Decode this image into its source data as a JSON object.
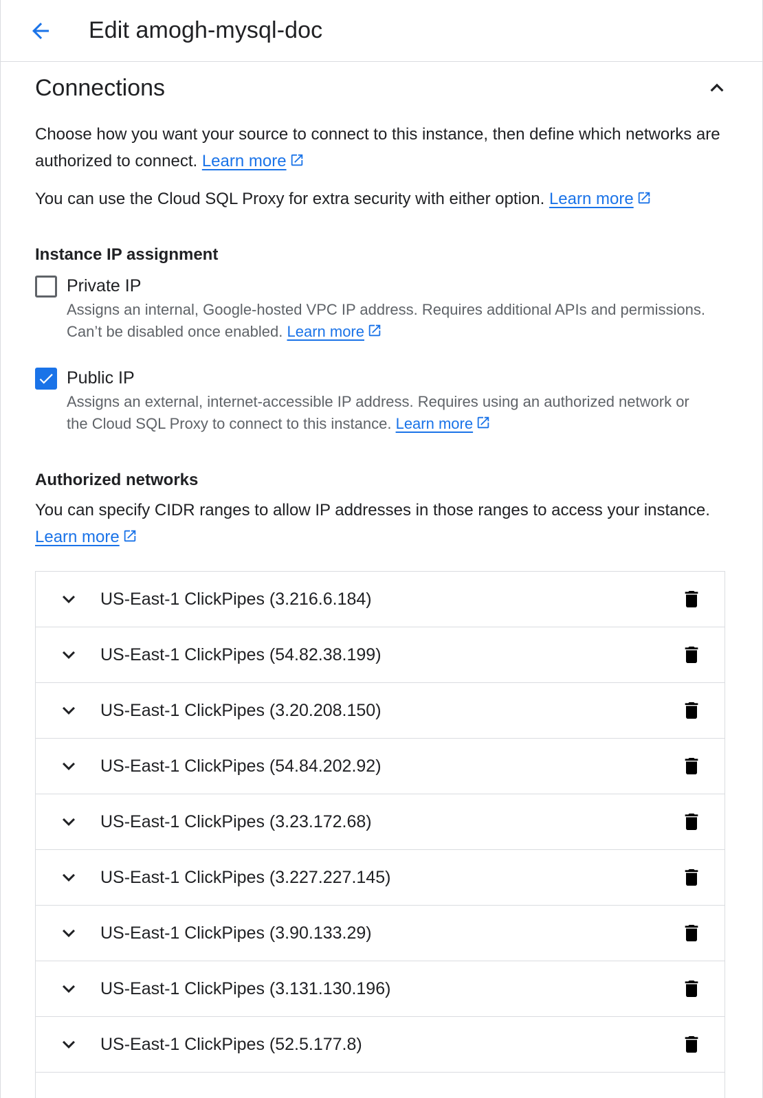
{
  "header": {
    "title": "Edit amogh-mysql-doc"
  },
  "section": {
    "title": "Connections",
    "intro_text": "Choose how you want your source to connect to this instance, then define which networks are authorized to connect.",
    "proxy_text": "You can use the Cloud SQL Proxy for extra security with either option.",
    "learn_more_label": "Learn more"
  },
  "ip_assignment": {
    "heading": "Instance IP assignment",
    "private": {
      "label": "Private IP",
      "checked": false,
      "description": "Assigns an internal, Google-hosted VPC IP address. Requires additional APIs and permissions. Can’t be disabled once enabled."
    },
    "public": {
      "label": "Public IP",
      "checked": true,
      "description": "Assigns an external, internet-accessible IP address. Requires using an authorized network or the Cloud SQL Proxy to connect to this instance."
    }
  },
  "authorized_networks": {
    "heading": "Authorized networks",
    "description": "You can specify CIDR ranges to allow IP addresses in those ranges to access your instance.",
    "items": [
      {
        "label": "US-East-1 ClickPipes (3.216.6.184)"
      },
      {
        "label": "US-East-1 ClickPipes (54.82.38.199)"
      },
      {
        "label": "US-East-1 ClickPipes (3.20.208.150)"
      },
      {
        "label": "US-East-1 ClickPipes (54.84.202.92)"
      },
      {
        "label": "US-East-1 ClickPipes (3.23.172.68)"
      },
      {
        "label": "US-East-1 ClickPipes (3.227.227.145)"
      },
      {
        "label": "US-East-1 ClickPipes (3.90.133.29)"
      },
      {
        "label": "US-East-1 ClickPipes (3.131.130.196)"
      },
      {
        "label": "US-East-1 ClickPipes (52.5.177.8)"
      }
    ]
  },
  "colors": {
    "accent": "#1a73e8",
    "text_primary": "#202124",
    "text_secondary": "#5f6368",
    "divider": "#dadce0"
  },
  "icons": {
    "back": "arrow-back-icon",
    "collapse": "chevron-up-icon",
    "external": "open-in-new-icon",
    "expand": "chevron-down-icon",
    "delete": "trash-icon",
    "check": "check-icon"
  }
}
